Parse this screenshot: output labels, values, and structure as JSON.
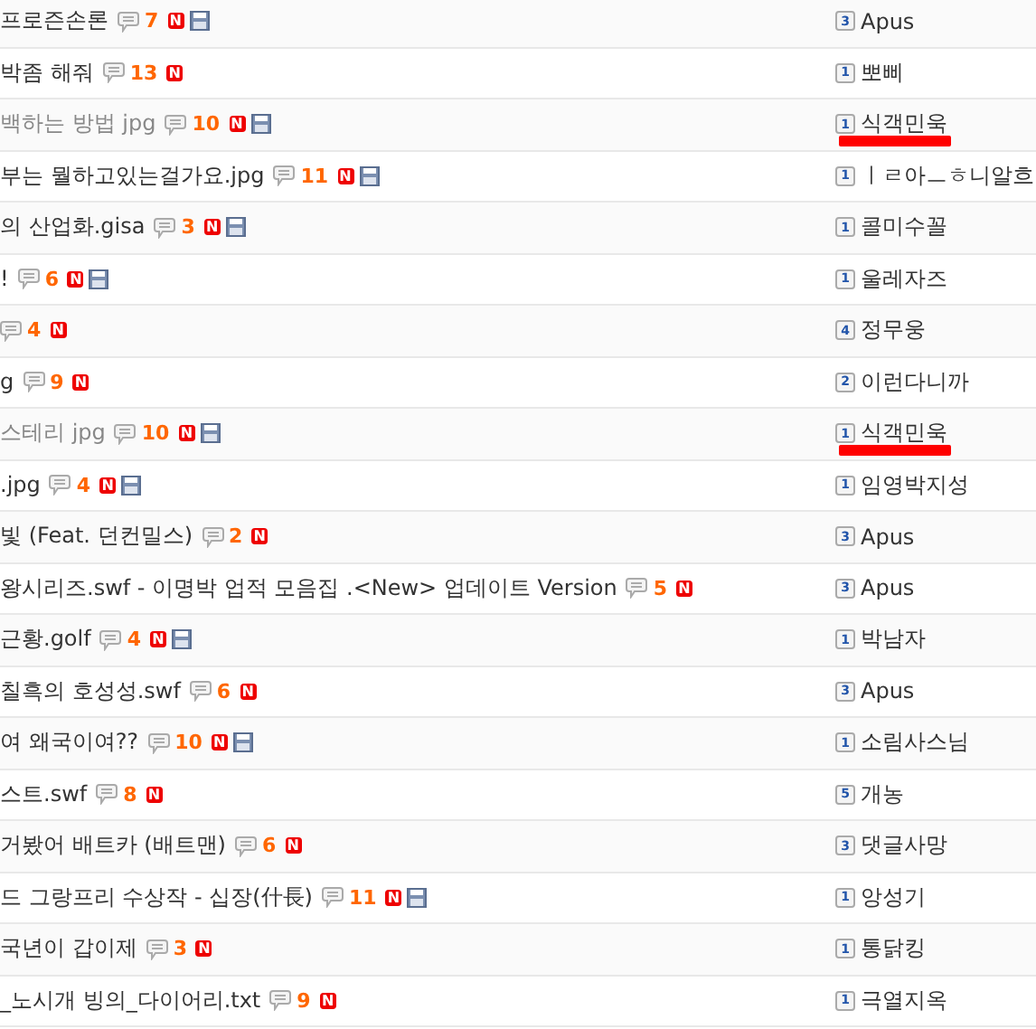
{
  "rows": [
    {
      "title": "프로즌손론",
      "visited": false,
      "comments": "7",
      "new_badge": "N",
      "attachment": true,
      "level": "3",
      "author": "Apus",
      "redacted": false
    },
    {
      "title": "박좀 해줘",
      "visited": false,
      "comments": "13",
      "new_badge": "N",
      "attachment": false,
      "level": "1",
      "author": "뽀삐",
      "redacted": false
    },
    {
      "title": "백하는 방법 jpg",
      "visited": true,
      "comments": "10",
      "new_badge": "N",
      "attachment": true,
      "level": "1",
      "author": "식객민욱",
      "redacted": true
    },
    {
      "title": "부는 뭘하고있는걸가요.jpg",
      "visited": false,
      "comments": "11",
      "new_badge": "N",
      "attachment": true,
      "level": "1",
      "author": "ㅣㄹ아ㅡㅎ니알흐",
      "redacted": false
    },
    {
      "title": "의 산업화.gisa",
      "visited": false,
      "comments": "3",
      "new_badge": "N",
      "attachment": true,
      "level": "1",
      "author": "콜미수꼴",
      "redacted": false
    },
    {
      "title": "!",
      "visited": false,
      "comments": "6",
      "new_badge": "N",
      "attachment": true,
      "level": "1",
      "author": "울레자즈",
      "redacted": false
    },
    {
      "comments": "4",
      "new_badge": "N",
      "attachment": false,
      "level": "4",
      "author": "정무웅",
      "redacted": false
    },
    {
      "title": "g",
      "visited": false,
      "comments": "9",
      "new_badge": "N",
      "attachment": false,
      "level": "2",
      "author": "이런다니까",
      "redacted": false
    },
    {
      "title": "스테리 jpg",
      "visited": true,
      "comments": "10",
      "new_badge": "N",
      "attachment": true,
      "level": "1",
      "author": "식객민욱",
      "redacted": true
    },
    {
      "title": ".jpg",
      "visited": false,
      "comments": "4",
      "new_badge": "N",
      "attachment": true,
      "level": "1",
      "author": "임영박지성",
      "redacted": false
    },
    {
      "title": "빛 (Feat. 던컨밀스)",
      "visited": false,
      "comments": "2",
      "new_badge": "N",
      "attachment": false,
      "level": "3",
      "author": "Apus",
      "redacted": false
    },
    {
      "title": "왕시리즈.swf - 이명박 업적 모음집 .<New> 업데이트 Version",
      "visited": false,
      "comments": "5",
      "new_badge": "N",
      "attachment": false,
      "level": "3",
      "author": "Apus",
      "redacted": false
    },
    {
      "title": "근황.golf",
      "visited": false,
      "comments": "4",
      "new_badge": "N",
      "attachment": true,
      "level": "1",
      "author": "박남자",
      "redacted": false
    },
    {
      "title": "칠흑의 호성성.swf",
      "visited": false,
      "comments": "6",
      "new_badge": "N",
      "attachment": false,
      "level": "3",
      "author": "Apus",
      "redacted": false
    },
    {
      "title": "여 왜국이여??",
      "visited": false,
      "comments": "10",
      "new_badge": "N",
      "attachment": true,
      "level": "1",
      "author": "소림사스님",
      "redacted": false
    },
    {
      "title": "스트.swf",
      "visited": false,
      "comments": "8",
      "new_badge": "N",
      "attachment": false,
      "level": "5",
      "author": "개농",
      "redacted": false
    },
    {
      "title": "거봤어 배트카 (배트맨)",
      "visited": false,
      "comments": "6",
      "new_badge": "N",
      "attachment": false,
      "level": "3",
      "author": "댓글사망",
      "redacted": false
    },
    {
      "title": "드 그랑프리 수상작 - 십장(什長)",
      "visited": false,
      "comments": "11",
      "new_badge": "N",
      "attachment": true,
      "level": "1",
      "author": "앙성기",
      "redacted": false
    },
    {
      "title": "국년이 갑이제",
      "visited": false,
      "comments": "3",
      "new_badge": "N",
      "attachment": false,
      "level": "1",
      "author": "통닭킹",
      "redacted": false
    },
    {
      "title": "_노시개 빙의_다이어리.txt",
      "visited": false,
      "comments": "9",
      "new_badge": "N",
      "attachment": false,
      "level": "1",
      "author": "극열지옥",
      "redacted": false
    }
  ]
}
